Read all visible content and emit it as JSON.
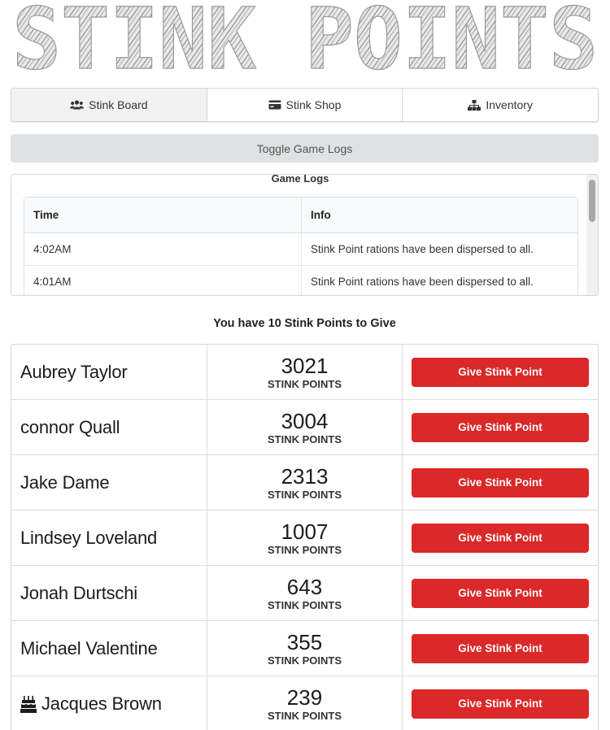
{
  "app": {
    "title": "STINK POINTS"
  },
  "tabs": [
    {
      "label": "Stink Board",
      "icon": "users-icon",
      "active": true
    },
    {
      "label": "Stink Shop",
      "icon": "credit-card-icon",
      "active": false
    },
    {
      "label": "Inventory",
      "icon": "sitemap-icon",
      "active": false
    }
  ],
  "toggle_logs_label": "Toggle Game Logs",
  "logs": {
    "title": "Game Logs",
    "columns": [
      "Time",
      "Info"
    ],
    "rows": [
      {
        "time": "4:02AM",
        "info": "Stink Point rations have been dispersed to all."
      },
      {
        "time": "4:01AM",
        "info": "Stink Point rations have been dispersed to all."
      }
    ]
  },
  "points_heading": "You have 10 Stink Points to Give",
  "points_label": "STINK POINTS",
  "give_button_label": "Give Stink Point",
  "players": [
    {
      "name": "Aubrey Taylor",
      "points": "3021",
      "icon": null
    },
    {
      "name": "connor Quall",
      "points": "3004",
      "icon": null
    },
    {
      "name": "Jake Dame",
      "points": "2313",
      "icon": null
    },
    {
      "name": "Lindsey Loveland",
      "points": "1007",
      "icon": null
    },
    {
      "name": "Jonah Durtschi",
      "points": "643",
      "icon": null
    },
    {
      "name": "Michael Valentine",
      "points": "355",
      "icon": null
    },
    {
      "name": "Jacques Brown",
      "points": "239",
      "icon": "birthday-cake-icon"
    }
  ],
  "colors": {
    "give_button": "#db2828",
    "toggle_button": "#e0e1e2",
    "active_tab": "#f2f2f2"
  }
}
